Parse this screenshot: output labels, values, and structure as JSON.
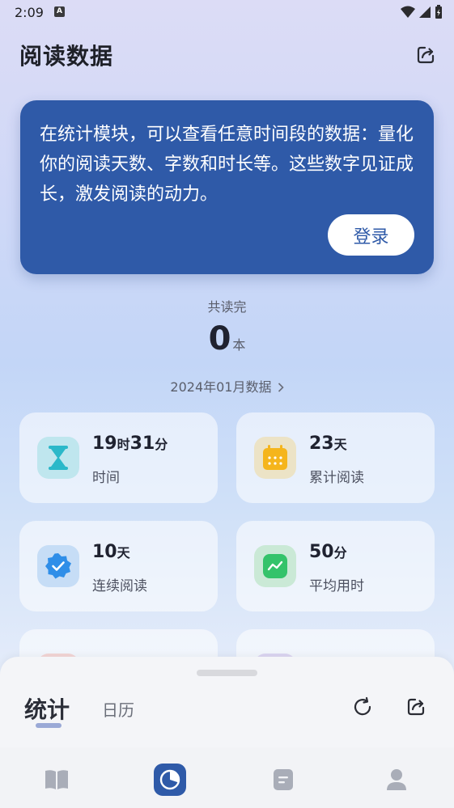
{
  "status_bar": {
    "time": "2:09",
    "a_badge": "A"
  },
  "header": {
    "title": "阅读数据",
    "share_icon": "share-icon"
  },
  "promo": {
    "text": "在统计模块，可以查看任意时间段的数据：量化你的阅读天数、字数和时长等。这些数字见证成长，激发阅读的动力。",
    "login_label": "登录",
    "bg_color": "#2f5aa8"
  },
  "summary": {
    "label": "共读完",
    "count": "0",
    "unit": "本",
    "month_link": "2024年01月数据"
  },
  "stats": [
    {
      "h": "19",
      "h_unit": "时",
      "m": "31",
      "m_unit": "分",
      "label": "时间",
      "icon": "hourglass-icon"
    },
    {
      "value": "23",
      "unit": "天",
      "label": "累计阅读",
      "icon": "calendar-icon"
    },
    {
      "value": "10",
      "unit": "天",
      "label": "连续阅读",
      "icon": "badge-check-icon"
    },
    {
      "value": "50",
      "unit": "分",
      "label": "平均用时",
      "icon": "trend-icon"
    }
  ],
  "sheet": {
    "tabs": [
      {
        "label": "统计",
        "active": true
      },
      {
        "label": "日历",
        "active": false
      }
    ]
  },
  "nav": {
    "items": [
      "book-icon",
      "stats-pie-icon",
      "note-icon",
      "profile-icon"
    ],
    "active_index": 1
  }
}
